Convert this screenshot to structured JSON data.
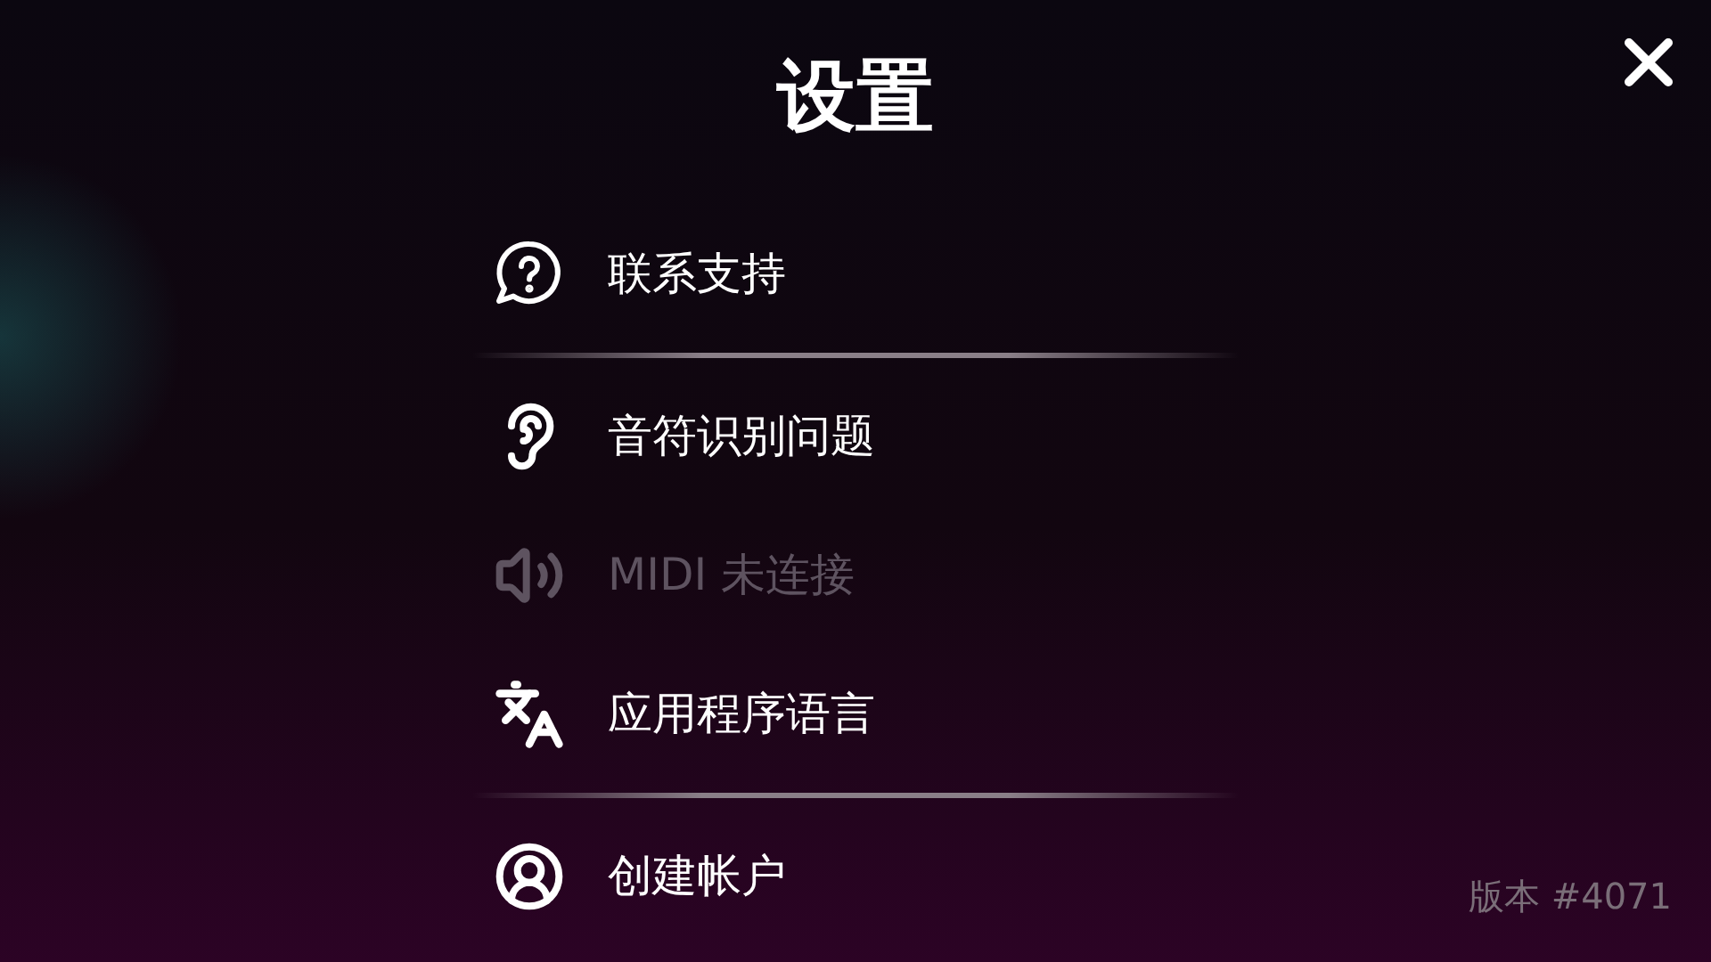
{
  "title": "设置",
  "sections": [
    [
      {
        "kind": "help",
        "label": "联系支持",
        "disabled": false
      }
    ],
    [
      {
        "kind": "ear",
        "label": "音符识别问题",
        "disabled": false
      },
      {
        "kind": "speaker",
        "label": "MIDI 未连接",
        "disabled": true
      },
      {
        "kind": "language",
        "label": "应用程序语言",
        "disabled": false
      }
    ],
    [
      {
        "kind": "account",
        "label": "创建帐户",
        "disabled": false
      }
    ]
  ],
  "version": "版本 #4071"
}
